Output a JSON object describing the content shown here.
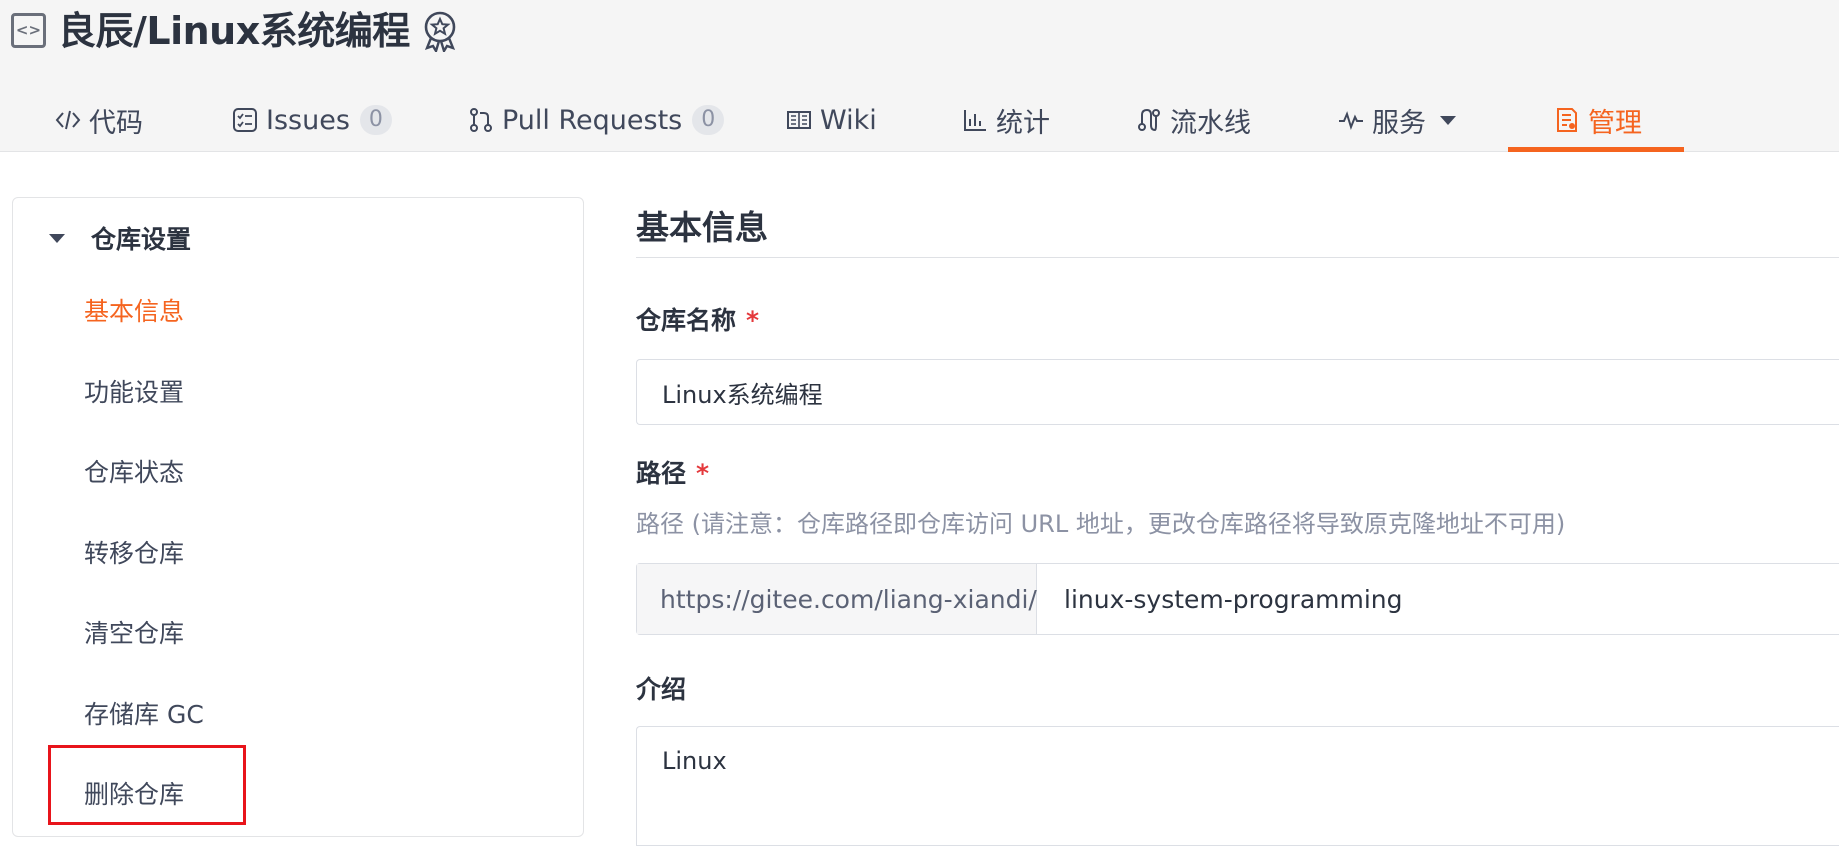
{
  "repo": {
    "owner_and_name": "良辰/Linux系统编程",
    "icons": {
      "repo": "code-repo-icon",
      "recommend": "award-badge-icon"
    }
  },
  "tabs": [
    {
      "label": "代码",
      "icon": "code-icon"
    },
    {
      "label": "Issues",
      "icon": "issues-icon",
      "count": "0"
    },
    {
      "label": "Pull Requests",
      "icon": "pull-request-icon",
      "count": "0"
    },
    {
      "label": "Wiki",
      "icon": "wiki-book-icon"
    },
    {
      "label": "统计",
      "icon": "bar-chart-icon"
    },
    {
      "label": "流水线",
      "icon": "pipeline-icon"
    },
    {
      "label": "服务",
      "icon": "pulse-icon",
      "has_dropdown": true
    },
    {
      "label": "管理",
      "icon": "manage-doc-icon",
      "active": true
    }
  ],
  "sidebar": {
    "group_title": "仓库设置",
    "items": [
      {
        "label": "基本信息",
        "active": true
      },
      {
        "label": "功能设置"
      },
      {
        "label": "仓库状态"
      },
      {
        "label": "转移仓库"
      },
      {
        "label": "清空仓库"
      },
      {
        "label": "存储库 GC"
      },
      {
        "label": "删除仓库",
        "highlighted": true
      }
    ]
  },
  "main": {
    "section_title": "基本信息",
    "name_field": {
      "label": "仓库名称",
      "required_mark": "*",
      "value": "Linux系统编程"
    },
    "path_field": {
      "label": "路径",
      "required_mark": "*",
      "hint": "路径 (请注意：仓库路径即仓库访问 URL 地址，更改仓库路径将导致原克隆地址不可用)",
      "prefix": "https://gitee.com/liang-xiandi/",
      "value": "linux-system-programming"
    },
    "intro_field": {
      "label": "介绍",
      "value": "Linux"
    }
  },
  "colors": {
    "accent": "#f5641f",
    "highlight_box": "#e8141b",
    "required": "#e4393c"
  }
}
